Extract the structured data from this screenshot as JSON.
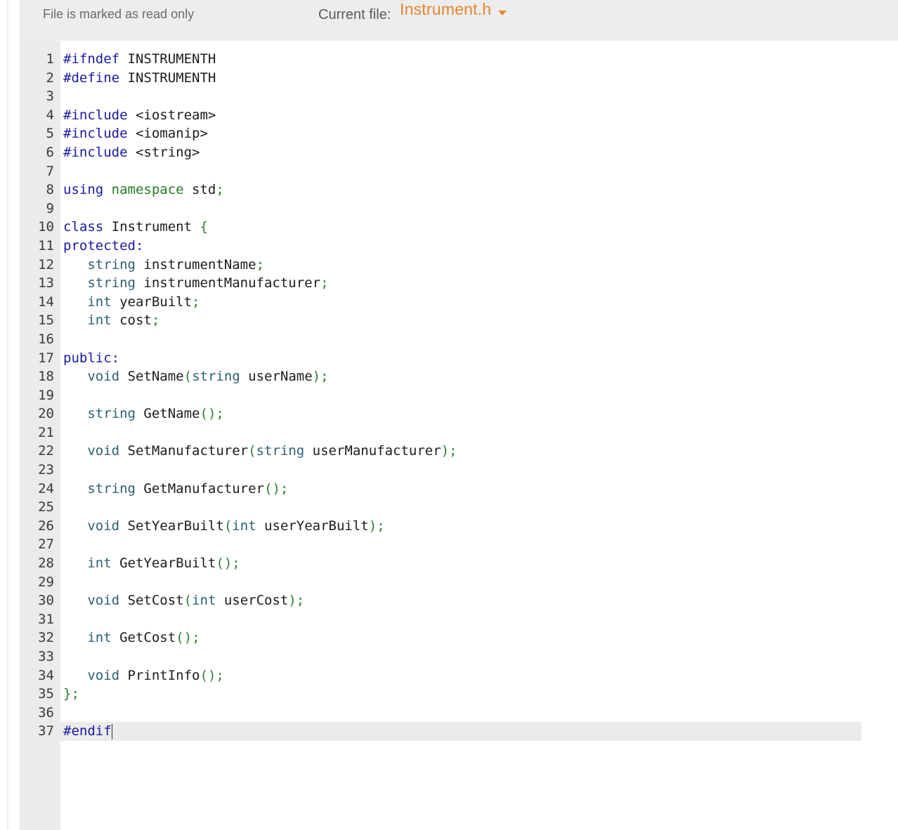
{
  "header": {
    "readonly_notice": "File is marked as read only",
    "current_file_label": "Current file:",
    "current_file_name": "Instrument.h"
  },
  "colors": {
    "accent": "#e8842f",
    "topbar_bg": "#ededed",
    "gutter_bg": "#ebebeb",
    "keyword": "#1a1aa6",
    "type": "#2d5f73",
    "punctuation": "#2e7d32"
  },
  "editor": {
    "active_line": 37,
    "lines": [
      {
        "n": "1",
        "text": "#ifndef INSTRUMENTH"
      },
      {
        "n": "2",
        "text": "#define INSTRUMENTH"
      },
      {
        "n": "3",
        "text": ""
      },
      {
        "n": "4",
        "text": "#include <iostream>"
      },
      {
        "n": "5",
        "text": "#include <iomanip>"
      },
      {
        "n": "6",
        "text": "#include <string>"
      },
      {
        "n": "7",
        "text": ""
      },
      {
        "n": "8",
        "text": "using namespace std;"
      },
      {
        "n": "9",
        "text": ""
      },
      {
        "n": "10",
        "text": "class Instrument {"
      },
      {
        "n": "11",
        "text": "protected:"
      },
      {
        "n": "12",
        "text": "   string instrumentName;"
      },
      {
        "n": "13",
        "text": "   string instrumentManufacturer;"
      },
      {
        "n": "14",
        "text": "   int yearBuilt;"
      },
      {
        "n": "15",
        "text": "   int cost;"
      },
      {
        "n": "16",
        "text": ""
      },
      {
        "n": "17",
        "text": "public:"
      },
      {
        "n": "18",
        "text": "   void SetName(string userName);"
      },
      {
        "n": "19",
        "text": ""
      },
      {
        "n": "20",
        "text": "   string GetName();"
      },
      {
        "n": "21",
        "text": ""
      },
      {
        "n": "22",
        "text": "   void SetManufacturer(string userManufacturer);"
      },
      {
        "n": "23",
        "text": ""
      },
      {
        "n": "24",
        "text": "   string GetManufacturer();"
      },
      {
        "n": "25",
        "text": ""
      },
      {
        "n": "26",
        "text": "   void SetYearBuilt(int userYearBuilt);"
      },
      {
        "n": "27",
        "text": ""
      },
      {
        "n": "28",
        "text": "   int GetYearBuilt();"
      },
      {
        "n": "29",
        "text": ""
      },
      {
        "n": "30",
        "text": "   void SetCost(int userCost);"
      },
      {
        "n": "31",
        "text": ""
      },
      {
        "n": "32",
        "text": "   int GetCost();"
      },
      {
        "n": "33",
        "text": ""
      },
      {
        "n": "34",
        "text": "   void PrintInfo();"
      },
      {
        "n": "35",
        "text": "};"
      },
      {
        "n": "36",
        "text": ""
      },
      {
        "n": "37",
        "text": "#endif"
      }
    ]
  }
}
